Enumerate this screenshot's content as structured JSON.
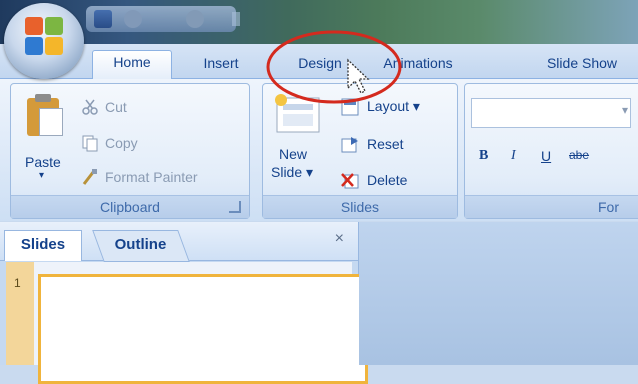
{
  "app": {
    "accent": "#15428b",
    "annotation_color": "#d42a1e"
  },
  "tabs": [
    {
      "label": "Home",
      "active": true
    },
    {
      "label": "Insert"
    },
    {
      "label": "Design"
    },
    {
      "label": "Animations"
    },
    {
      "label": "Slide Show"
    }
  ],
  "clipboard": {
    "paste_label": "Paste",
    "cut_label": "Cut",
    "copy_label": "Copy",
    "format_painter_label": "Format Painter",
    "group_label": "Clipboard"
  },
  "slides_group": {
    "new_slide_label_1": "New",
    "new_slide_label_2": "Slide ▾",
    "layout_label": "Layout ▾",
    "reset_label": "Reset",
    "delete_label": "Delete",
    "group_label": "Slides"
  },
  "font_group": {
    "group_label": "For",
    "bold": "B",
    "italic": "I",
    "underline": "U",
    "strike": "abe"
  },
  "panel": {
    "slides_tab": "Slides",
    "outline_tab": "Outline",
    "close": "×",
    "slide_number": "1"
  }
}
